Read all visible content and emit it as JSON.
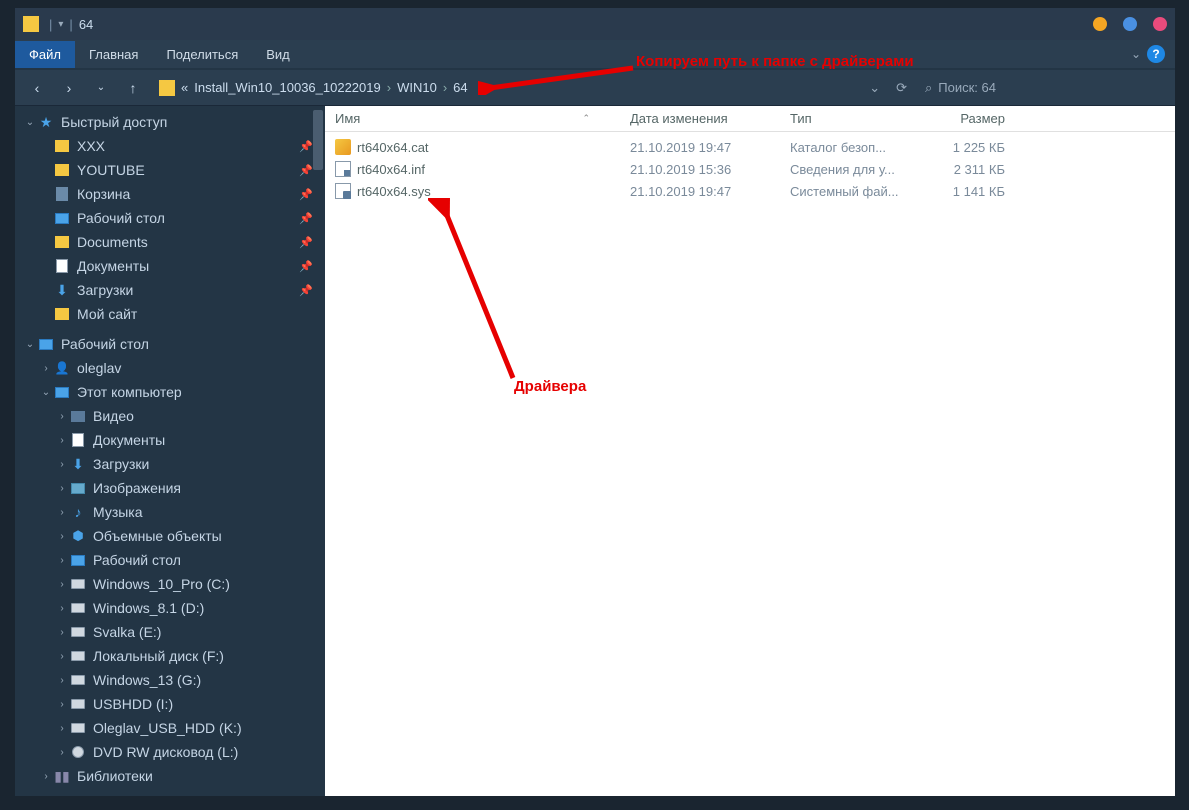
{
  "titlebar": {
    "title": "64"
  },
  "menu": {
    "file": "Файл",
    "home": "Главная",
    "share": "Поделиться",
    "view": "Вид"
  },
  "breadcrumb": {
    "prefix": "«",
    "seg1": "Install_Win10_10036_10222019",
    "seg2": "WIN10",
    "seg3": "64"
  },
  "search": {
    "label": "Поиск: 64"
  },
  "columns": {
    "name": "Имя",
    "date": "Дата изменения",
    "type": "Тип",
    "size": "Размер"
  },
  "files": [
    {
      "name": "rt640x64.cat",
      "date": "21.10.2019 19:47",
      "type": "Каталог безоп...",
      "size": "1 225 КБ",
      "icon": "cat"
    },
    {
      "name": "rt640x64.inf",
      "date": "21.10.2019 15:36",
      "type": "Сведения для у...",
      "size": "2 311 КБ",
      "icon": "inf"
    },
    {
      "name": "rt640x64.sys",
      "date": "21.10.2019 19:47",
      "type": "Системный фай...",
      "size": "1 141 КБ",
      "icon": "sys"
    }
  ],
  "sidebar": {
    "quick": "Быстрый доступ",
    "q_items": [
      "XXX",
      "YOUTUBE",
      "Корзина",
      "Рабочий стол",
      "Documents",
      "Документы",
      "Загрузки",
      "Мой сайт"
    ],
    "desktop": "Рабочий стол",
    "user": "oleglav",
    "thispc": "Этот компьютер",
    "pc_items": [
      "Видео",
      "Документы",
      "Загрузки",
      "Изображения",
      "Музыка",
      "Объемные объекты",
      "Рабочий стол",
      "Windows_10_Pro (C:)",
      "Windows_8.1 (D:)",
      "Svalka (E:)",
      "Локальный диск (F:)",
      "Windows_13 (G:)",
      "USBHDD (I:)",
      "Oleglav_USB_HDD (K:)",
      "DVD RW дисковод (L:)"
    ],
    "libraries": "Библиотеки"
  },
  "annotations": {
    "a1": "Копируем путь к папке с драйверами",
    "a2": "Драйвера"
  }
}
